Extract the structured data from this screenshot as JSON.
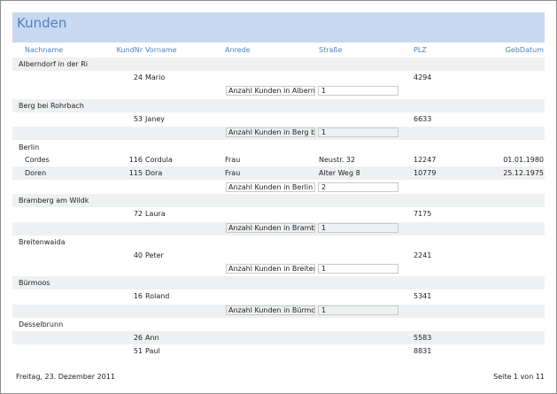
{
  "report": {
    "title": "Kunden"
  },
  "columns": {
    "nachname": "Nachname",
    "kundnr": "KundNr",
    "vorname": "Vorname",
    "anrede": "Anrede",
    "strasse": "Straße",
    "plz": "PLZ",
    "gebdatum": "GebDatum"
  },
  "groups": [
    {
      "ort": "Alberndorf in der Ri",
      "customers": [
        {
          "nachname": "",
          "kundnr": "24",
          "vorname": "Mario",
          "anrede": "",
          "strasse": "",
          "plz": "4294",
          "gebdatum": ""
        }
      ],
      "sum_label": "Anzahl Kunden in Alberndorf i",
      "sum_value": "1"
    },
    {
      "ort": "Berg bei Rohrbach",
      "customers": [
        {
          "nachname": "",
          "kundnr": "53",
          "vorname": "Janey",
          "anrede": "",
          "strasse": "",
          "plz": "6633",
          "gebdatum": ""
        }
      ],
      "sum_label": "Anzahl Kunden in Berg bei Ro",
      "sum_value": "1"
    },
    {
      "ort": "Berlin",
      "customers": [
        {
          "nachname": "Cordes",
          "kundnr": "116",
          "vorname": "Cordula",
          "anrede": "Frau",
          "strasse": "Neustr. 32",
          "plz": "12247",
          "gebdatum": "01.01.1980"
        },
        {
          "nachname": "Doren",
          "kundnr": "115",
          "vorname": "Dora",
          "anrede": "Frau",
          "strasse": "Alter Weg 8",
          "plz": "10779",
          "gebdatum": "25.12.1975"
        }
      ],
      "sum_label": "Anzahl Kunden in Berlin",
      "sum_value": "2"
    },
    {
      "ort": "Bramberg am Wildk",
      "customers": [
        {
          "nachname": "",
          "kundnr": "72",
          "vorname": "Laura",
          "anrede": "",
          "strasse": "",
          "plz": "7175",
          "gebdatum": ""
        }
      ],
      "sum_label": "Anzahl Kunden in Bramberg a",
      "sum_value": "1"
    },
    {
      "ort": "Breitenwaida",
      "customers": [
        {
          "nachname": "",
          "kundnr": "40",
          "vorname": "Peter",
          "anrede": "",
          "strasse": "",
          "plz": "2241",
          "gebdatum": ""
        }
      ],
      "sum_label": "Anzahl Kunden in Breitenwaid",
      "sum_value": "1"
    },
    {
      "ort": "Bürmoos",
      "customers": [
        {
          "nachname": "",
          "kundnr": "16",
          "vorname": "Roland",
          "anrede": "",
          "strasse": "",
          "plz": "5341",
          "gebdatum": ""
        }
      ],
      "sum_label": "Anzahl Kunden in Bürmoos",
      "sum_value": "1"
    },
    {
      "ort": "Desselbrunn",
      "customers": [
        {
          "nachname": "",
          "kundnr": "26",
          "vorname": "Ann",
          "anrede": "",
          "strasse": "",
          "plz": "5583",
          "gebdatum": ""
        },
        {
          "nachname": "",
          "kundnr": "51",
          "vorname": "Paul",
          "anrede": "",
          "strasse": "",
          "plz": "8831",
          "gebdatum": ""
        }
      ]
    }
  ],
  "footer": {
    "date": "Freitag, 23. Dezember 2011",
    "page": "Seite 1 von 11"
  }
}
